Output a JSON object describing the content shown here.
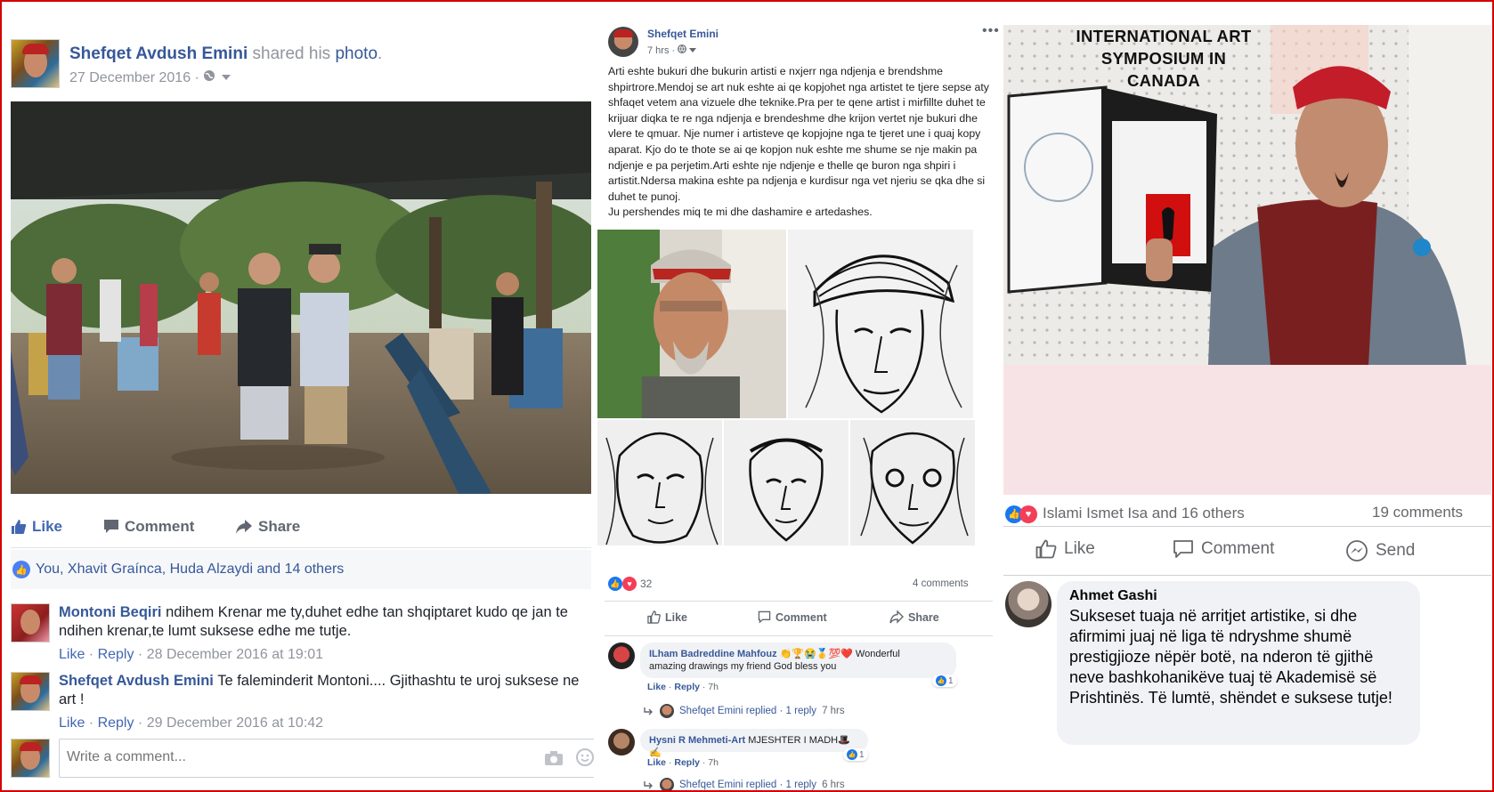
{
  "panel1": {
    "author": "Shefqet Avdush Emini",
    "shared_text": "shared his",
    "shared_link": "photo",
    "shared_end": ".",
    "date": "27 December 2016 · ",
    "actions": {
      "like": "Like",
      "comment": "Comment",
      "share": "Share"
    },
    "likes_summary": "You, Xhavit Graínca, Huda Alzaydi and 14 others",
    "comments": [
      {
        "author": "Montoni Beqiri",
        "text": "ndihem Krenar me ty,duhet edhe tan shqiptaret kudo qe jan te ndihen krenar,te lumt suksese edhe me tutje.",
        "like": "Like",
        "reply": "Reply",
        "time": "28 December 2016 at 19:01"
      },
      {
        "author": "Shefqet Avdush Emini",
        "text": "Te faleminderit Montoni.... Gjithashtu te uroj suksese ne art !",
        "like": "Like",
        "reply": "Reply",
        "time": "29 December 2016 at 10:42"
      }
    ],
    "write_placeholder": "Write a comment..."
  },
  "panel2": {
    "author": "Shefqet Emini",
    "time": "7 hrs · ",
    "post_text": "Arti eshte bukuri dhe bukurin artisti e nxjerr nga ndjenja e brendshme shpirtrore.Mendoj se art nuk eshte ai qe kopjohet nga artistet te tjere sepse aty shfaqet vetem ana vizuele dhe teknike.Pra per te qene artist i mirfillte duhet te krijuar diqka te re nga ndjenja e brendeshme dhe krijon vertet nje bukuri dhe vlere te qmuar. Nje numer i artisteve qe kopjojne nga te tjeret une i quaj kopy aparat. Kjo do te thote se ai qe kopjon nuk eshte me shume se nje makin pa ndjenje e pa perjetim.Arti eshte nje ndjenje e thelle qe buron nga shpiri i artistit.Ndersa makina eshte pa ndjenja e kurdisur nga vet njeriu se qka dhe si duhet te punoj.",
    "post_text_2": "Ju pershendes miq te mi dhe dashamire e artedashes.",
    "reactions_count": "32",
    "comments_count": "4 comments",
    "actions": {
      "like": "Like",
      "comment": "Comment",
      "share": "Share"
    },
    "comments": [
      {
        "author": "ILham Badreddine Mahfouz",
        "emoji": "👏🏆😭🥇💯❤️",
        "text": " Wonderful",
        "text2": "amazing drawings my friend God bless you",
        "like": "Like",
        "reply": "Reply",
        "time": "7h",
        "badge": "1"
      },
      {
        "author": "Hysni R Mehmeti-Art",
        "text": " MJESHTER I MADH",
        "emoji": "🎩✍️",
        "like": "Like",
        "reply": "Reply",
        "time": "7h",
        "badge": "1"
      }
    ],
    "reply_lines": [
      {
        "who": "Shefqet Emini replied · 1 reply",
        "time": "7 hrs"
      },
      {
        "who": "Shefqet Emini replied · 1 reply",
        "time": "6 hrs"
      }
    ]
  },
  "panel3": {
    "banner": [
      "INTERNATIONAL ART",
      "SYMPOSIUM IN",
      "CANADA"
    ],
    "reactions_text": "Islami Ismet Isa and 16 others",
    "comments_count": "19 comments",
    "actions": {
      "like": "Like",
      "comment": "Comment",
      "send": "Send"
    },
    "comment": {
      "author": "Ahmet Gashi",
      "text": "Sukseset tuaja në arritjet artistike, si dhe afirmimi juaj në liga të ndryshme shumë prestigjioze nëpër botë, na nderon të gjithë neve bashkohanikëve tuaj të Akademisë së Prishtinës. Të lumtë, shëndet e suksese tutje!"
    }
  },
  "colors": {
    "fb_link": "#365899",
    "fb_blue": "#4267b2",
    "muted": "#90949c",
    "frame_border": "#d40000",
    "pink_area": "#f7e3e6"
  }
}
